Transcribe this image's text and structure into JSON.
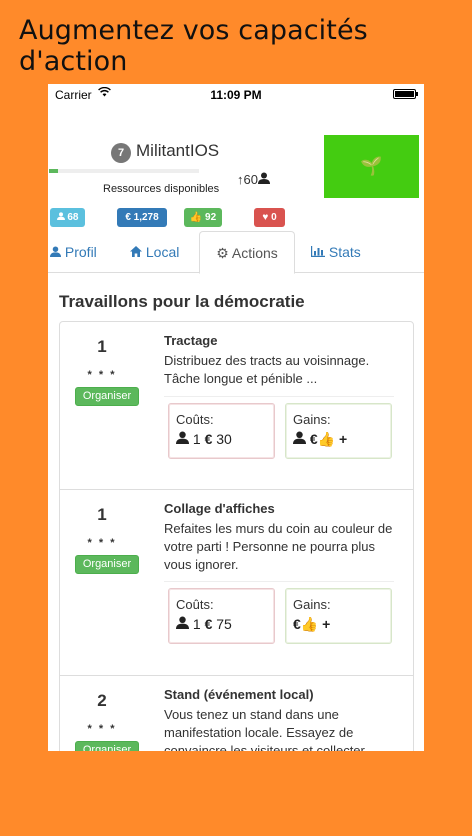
{
  "promo_title": "Augmentez vos capacités d'action",
  "status_bar": {
    "carrier": "Carrier",
    "wifi_icon": "wifi-icon",
    "time": "11:09 PM",
    "battery_icon": "battery-icon"
  },
  "header": {
    "level": "7",
    "username": "MilitantIOS",
    "progress_fraction": 0.06,
    "count_arrow": "↑",
    "count": "60",
    "person_icon": "user-icon",
    "green_box_icon": "sprout-icon",
    "green_box_glyph": "🌱"
  },
  "resources": {
    "title": "Ressources disponibles",
    "badges": [
      {
        "icon": "user-icon",
        "glyph": "👤",
        "value": "68",
        "color": "#5bc0de"
      },
      {
        "icon": "euro-icon",
        "glyph": "€",
        "value": "1,278",
        "color": "#337ab7"
      },
      {
        "icon": "thumbs-up-icon",
        "glyph": "👍",
        "value": "92",
        "color": "#5cb85c"
      },
      {
        "icon": "heart-icon",
        "glyph": "♥",
        "value": "0",
        "color": "#d9534f"
      }
    ]
  },
  "tabs": [
    {
      "label": "Profil",
      "icon": "user-icon",
      "glyph": "👤"
    },
    {
      "label": "Local",
      "icon": "home-icon",
      "glyph": "⌂"
    },
    {
      "label": "Actions",
      "icon": "gear-icon",
      "glyph": "⚙"
    },
    {
      "label": "Stats",
      "icon": "bar-chart-icon",
      "glyph": "▥"
    }
  ],
  "section_title": "Travaillons pour la démocratie",
  "actions": [
    {
      "number": "1",
      "stars": "* * *",
      "button": "Organiser",
      "name": "Tractage",
      "description": "Distribuez des tracts au voisinnage. Tâche longue et pénible ...",
      "costs_label": "Coûts:",
      "costs_value": "1",
      "costs_euro": "30",
      "gains_label": "Gains:"
    },
    {
      "number": "1",
      "stars": "* * *",
      "button": "Organiser",
      "name": "Collage d'affiches",
      "description": "Refaites les murs du coin au couleur de votre parti ! Personne ne pourra plus vous ignorer.",
      "costs_label": "Coûts:",
      "costs_value": "1",
      "costs_euro": "75",
      "gains_label": "Gains:"
    },
    {
      "number": "2",
      "stars": "* * *",
      "button": "Organiser",
      "name": "Stand (événement local)",
      "description": "Vous tenez un stand dans une manifestation locale. Essayez de convaincre les visiteurs et collecter"
    }
  ]
}
